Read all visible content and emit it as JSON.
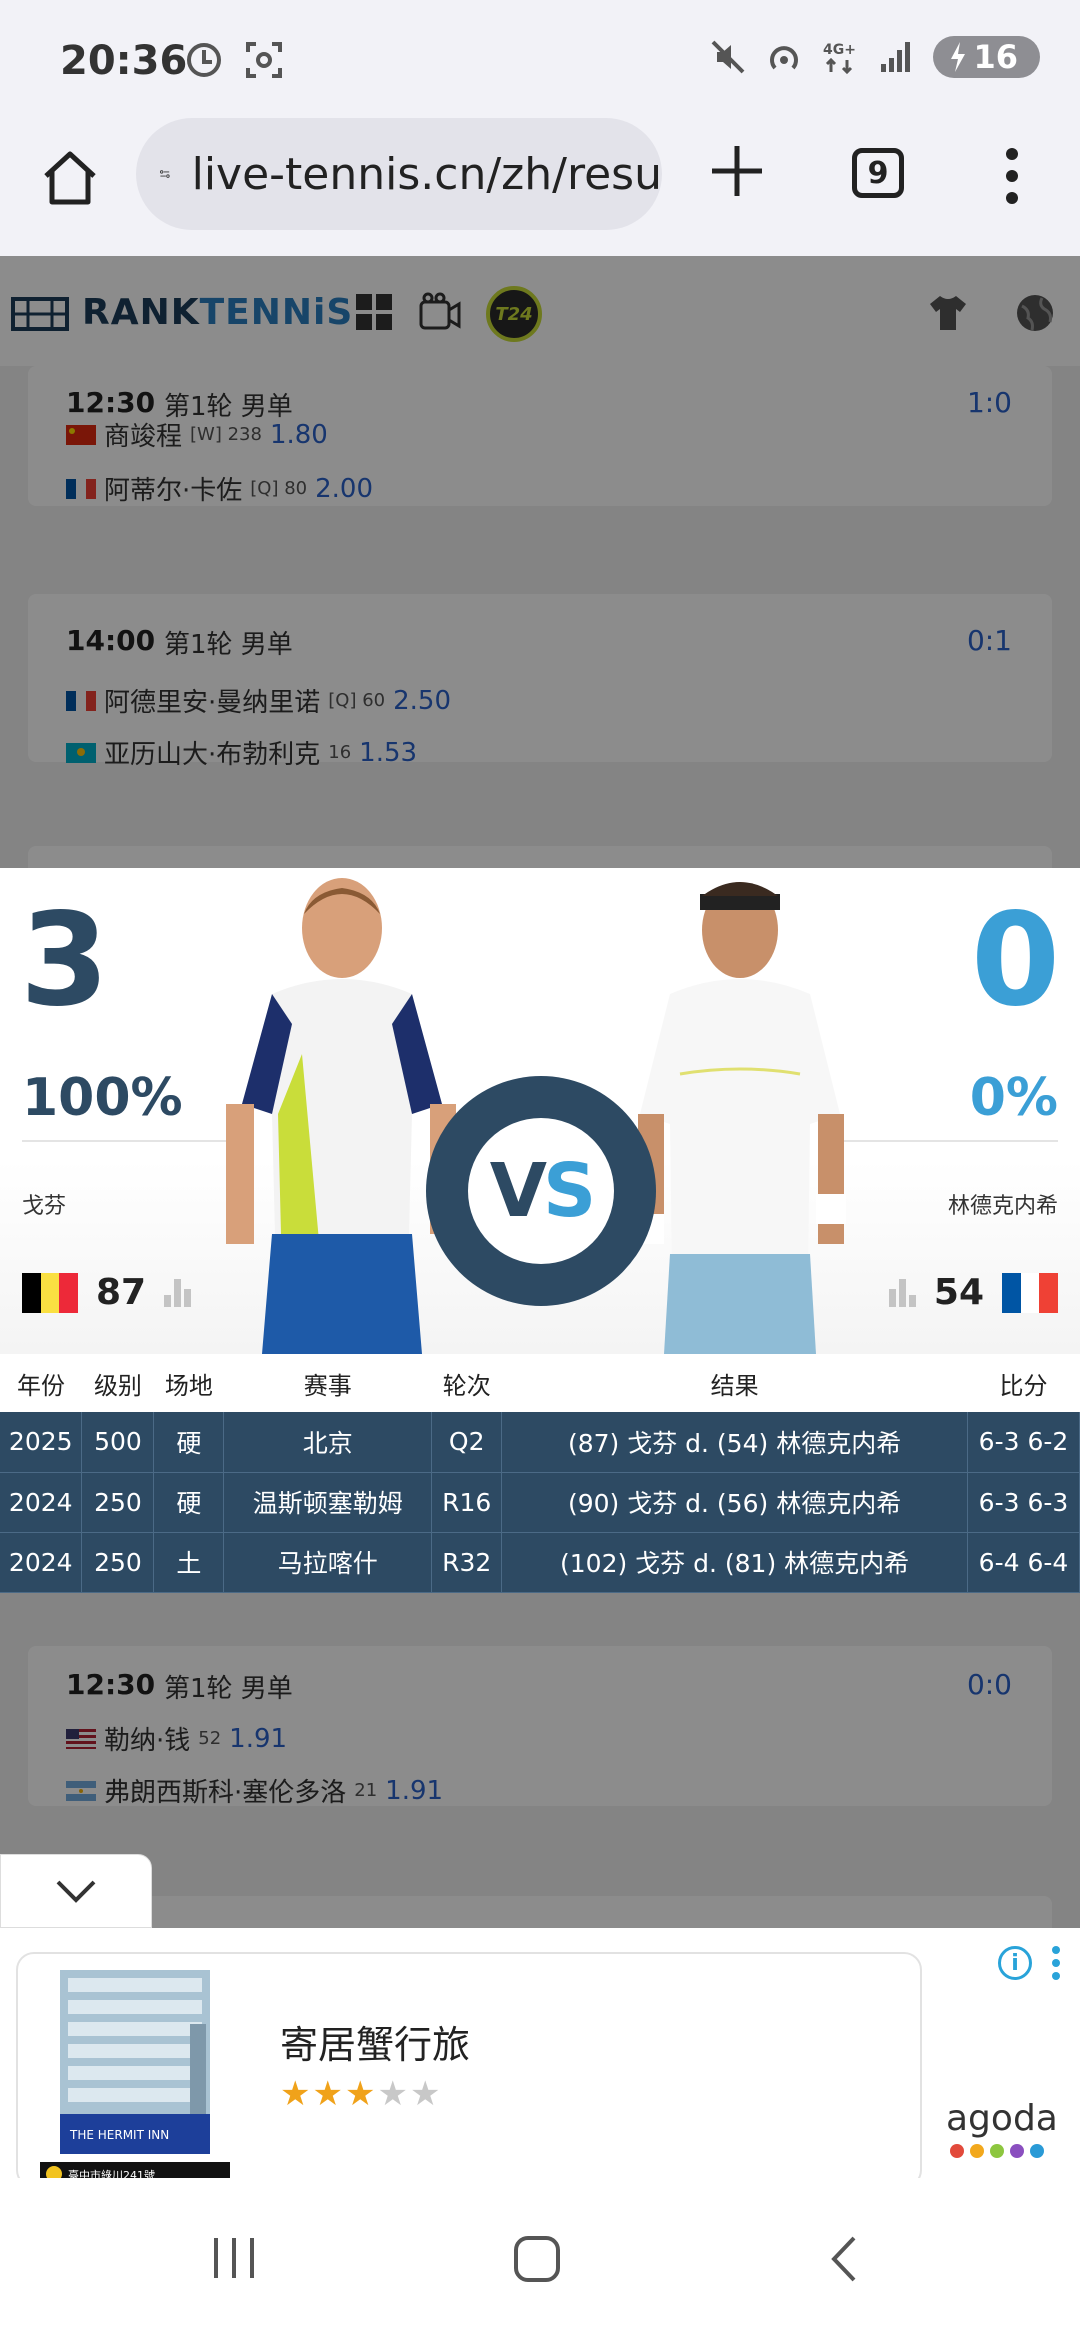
{
  "status_bar": {
    "time": "20:36",
    "battery": "16"
  },
  "browser": {
    "url": "live-tennis.cn/zh/resu",
    "tab_count": "9"
  },
  "site": {
    "logo_text_dark": "RANK",
    "logo_text_blue": "TENNiS",
    "t24_badge": "T24"
  },
  "matches_top": [
    {
      "time": "12:30",
      "round": "第1轮 男单",
      "score": "1:0",
      "p1": {
        "name": "商竣程",
        "seed": "[W] 238",
        "odds": "1.80",
        "flag": "china"
      },
      "p2": {
        "name": "阿蒂尔·卡佐",
        "seed": "[Q] 80",
        "odds": "2.00",
        "flag": "france"
      }
    },
    {
      "time": "14:00",
      "round": "第1轮 男单",
      "score": "0:1",
      "p1": {
        "name": "阿德里安·曼纳里诺",
        "seed": "[Q] 60",
        "odds": "2.50",
        "flag": "france"
      },
      "p2": {
        "name": "亚历山大·布勃利克",
        "seed": "16",
        "odds": "1.53",
        "flag": "kazakhstan"
      }
    }
  ],
  "matches_bottom": [
    {
      "time": "12:30",
      "round": "第1轮 男单",
      "score": "0:0",
      "p1": {
        "name": "勒纳·钱",
        "seed": "52",
        "odds": "1.91",
        "flag": "usa"
      },
      "p2": {
        "name": "弗朗西斯科·塞伦多洛",
        "seed": "21",
        "odds": "1.91",
        "flag": "argentina"
      }
    }
  ],
  "h2h": {
    "left": {
      "wins": "3",
      "pct": "100%",
      "name": "戈芬",
      "rank": "87",
      "flag": "belgium"
    },
    "right": {
      "wins": "0",
      "pct": "0%",
      "name": "林德克内希",
      "rank": "54",
      "flag": "france"
    },
    "vs_v": "V",
    "vs_s": "S",
    "columns": [
      "年份",
      "级别",
      "场地",
      "赛事",
      "轮次",
      "结果",
      "比分"
    ],
    "rows": [
      [
        "2025",
        "500",
        "硬",
        "北京",
        "Q2",
        "(87) 戈芬 d. (54) 林德克内希",
        "6-3 6-2"
      ],
      [
        "2024",
        "250",
        "硬",
        "温斯顿塞勒姆",
        "R16",
        "(90) 戈芬 d. (56) 林德克内希",
        "6-3 6-3"
      ],
      [
        "2024",
        "250",
        "土",
        "马拉喀什",
        "R32",
        "(102) 戈芬 d. (81) 林德克内希",
        "6-4 6-4"
      ]
    ]
  },
  "ad": {
    "title": "寄居蟹行旅",
    "rating": 3,
    "max_rating": 5,
    "brand": "agoda",
    "hotel_sign": "THE HERMIT INN",
    "hotel_sub": "臺中市綠川241號",
    "brand_colors": [
      "#e24a3b",
      "#f2a81d",
      "#8dc63f",
      "#8a4fbf",
      "#2a9ad6"
    ]
  },
  "colors": {
    "navy": "#2d4a63",
    "light_blue": "#3b9fd6",
    "odds_blue": "#2a62c9"
  }
}
